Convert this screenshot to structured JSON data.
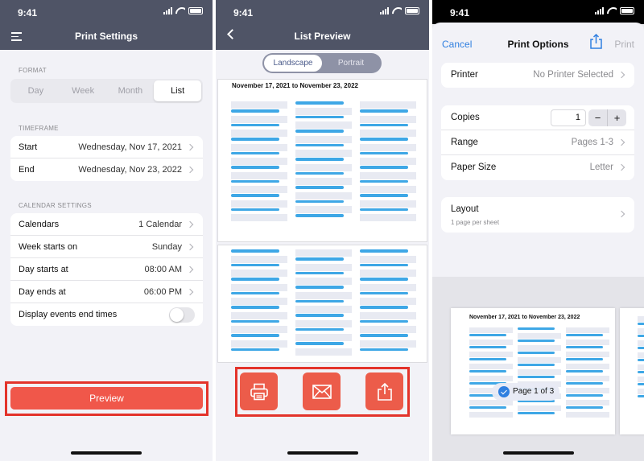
{
  "status": {
    "time": "9:41"
  },
  "print_settings": {
    "title": "Print Settings",
    "format_label": "FORMAT",
    "format_options": [
      "Day",
      "Week",
      "Month",
      "List"
    ],
    "format_selected": "List",
    "timeframe_label": "TIMEFRAME",
    "start_label": "Start",
    "start_value": "Wednesday, Nov 17, 2021",
    "end_label": "End",
    "end_value": "Wednesday, Nov 23, 2022",
    "calendar_settings_label": "CALENDAR SETTINGS",
    "calendars_label": "Calendars",
    "calendars_value": "1 Calendar",
    "week_starts_label": "Week starts on",
    "week_starts_value": "Sunday",
    "day_starts_label": "Day starts at",
    "day_starts_value": "08:00 AM",
    "day_ends_label": "Day ends at",
    "day_ends_value": "06:00 PM",
    "display_end_times_label": "Display events end times",
    "display_end_times_on": false,
    "preview_label": "Preview"
  },
  "list_preview": {
    "title": "List Preview",
    "orientations": [
      "Landscape",
      "Portrait"
    ],
    "orientation_selected": "Landscape",
    "page_title": "November 17, 2021 to November 23, 2022",
    "actions": [
      "print-icon",
      "mail-icon",
      "share-icon"
    ]
  },
  "print_options": {
    "cancel_label": "Cancel",
    "title": "Print Options",
    "print_label": "Print",
    "printer_label": "Printer",
    "printer_value": "No Printer Selected",
    "copies_label": "Copies",
    "copies_value": "1",
    "minus_label": "−",
    "plus_label": "+",
    "range_label": "Range",
    "range_value": "Pages 1-3",
    "paper_size_label": "Paper Size",
    "paper_size_value": "Letter",
    "layout_label": "Layout",
    "layout_sub": "1 page per sheet",
    "thumb_title": "November 17, 2021 to November 23, 2022",
    "page_indicator": "Page 1 of 3"
  },
  "colors": {
    "nav": "#4f5466",
    "accent_red": "#f0574a",
    "highlight": "#e3332a",
    "ios_blue": "#2f7fe0",
    "event_blue": "#3ea7e6"
  }
}
